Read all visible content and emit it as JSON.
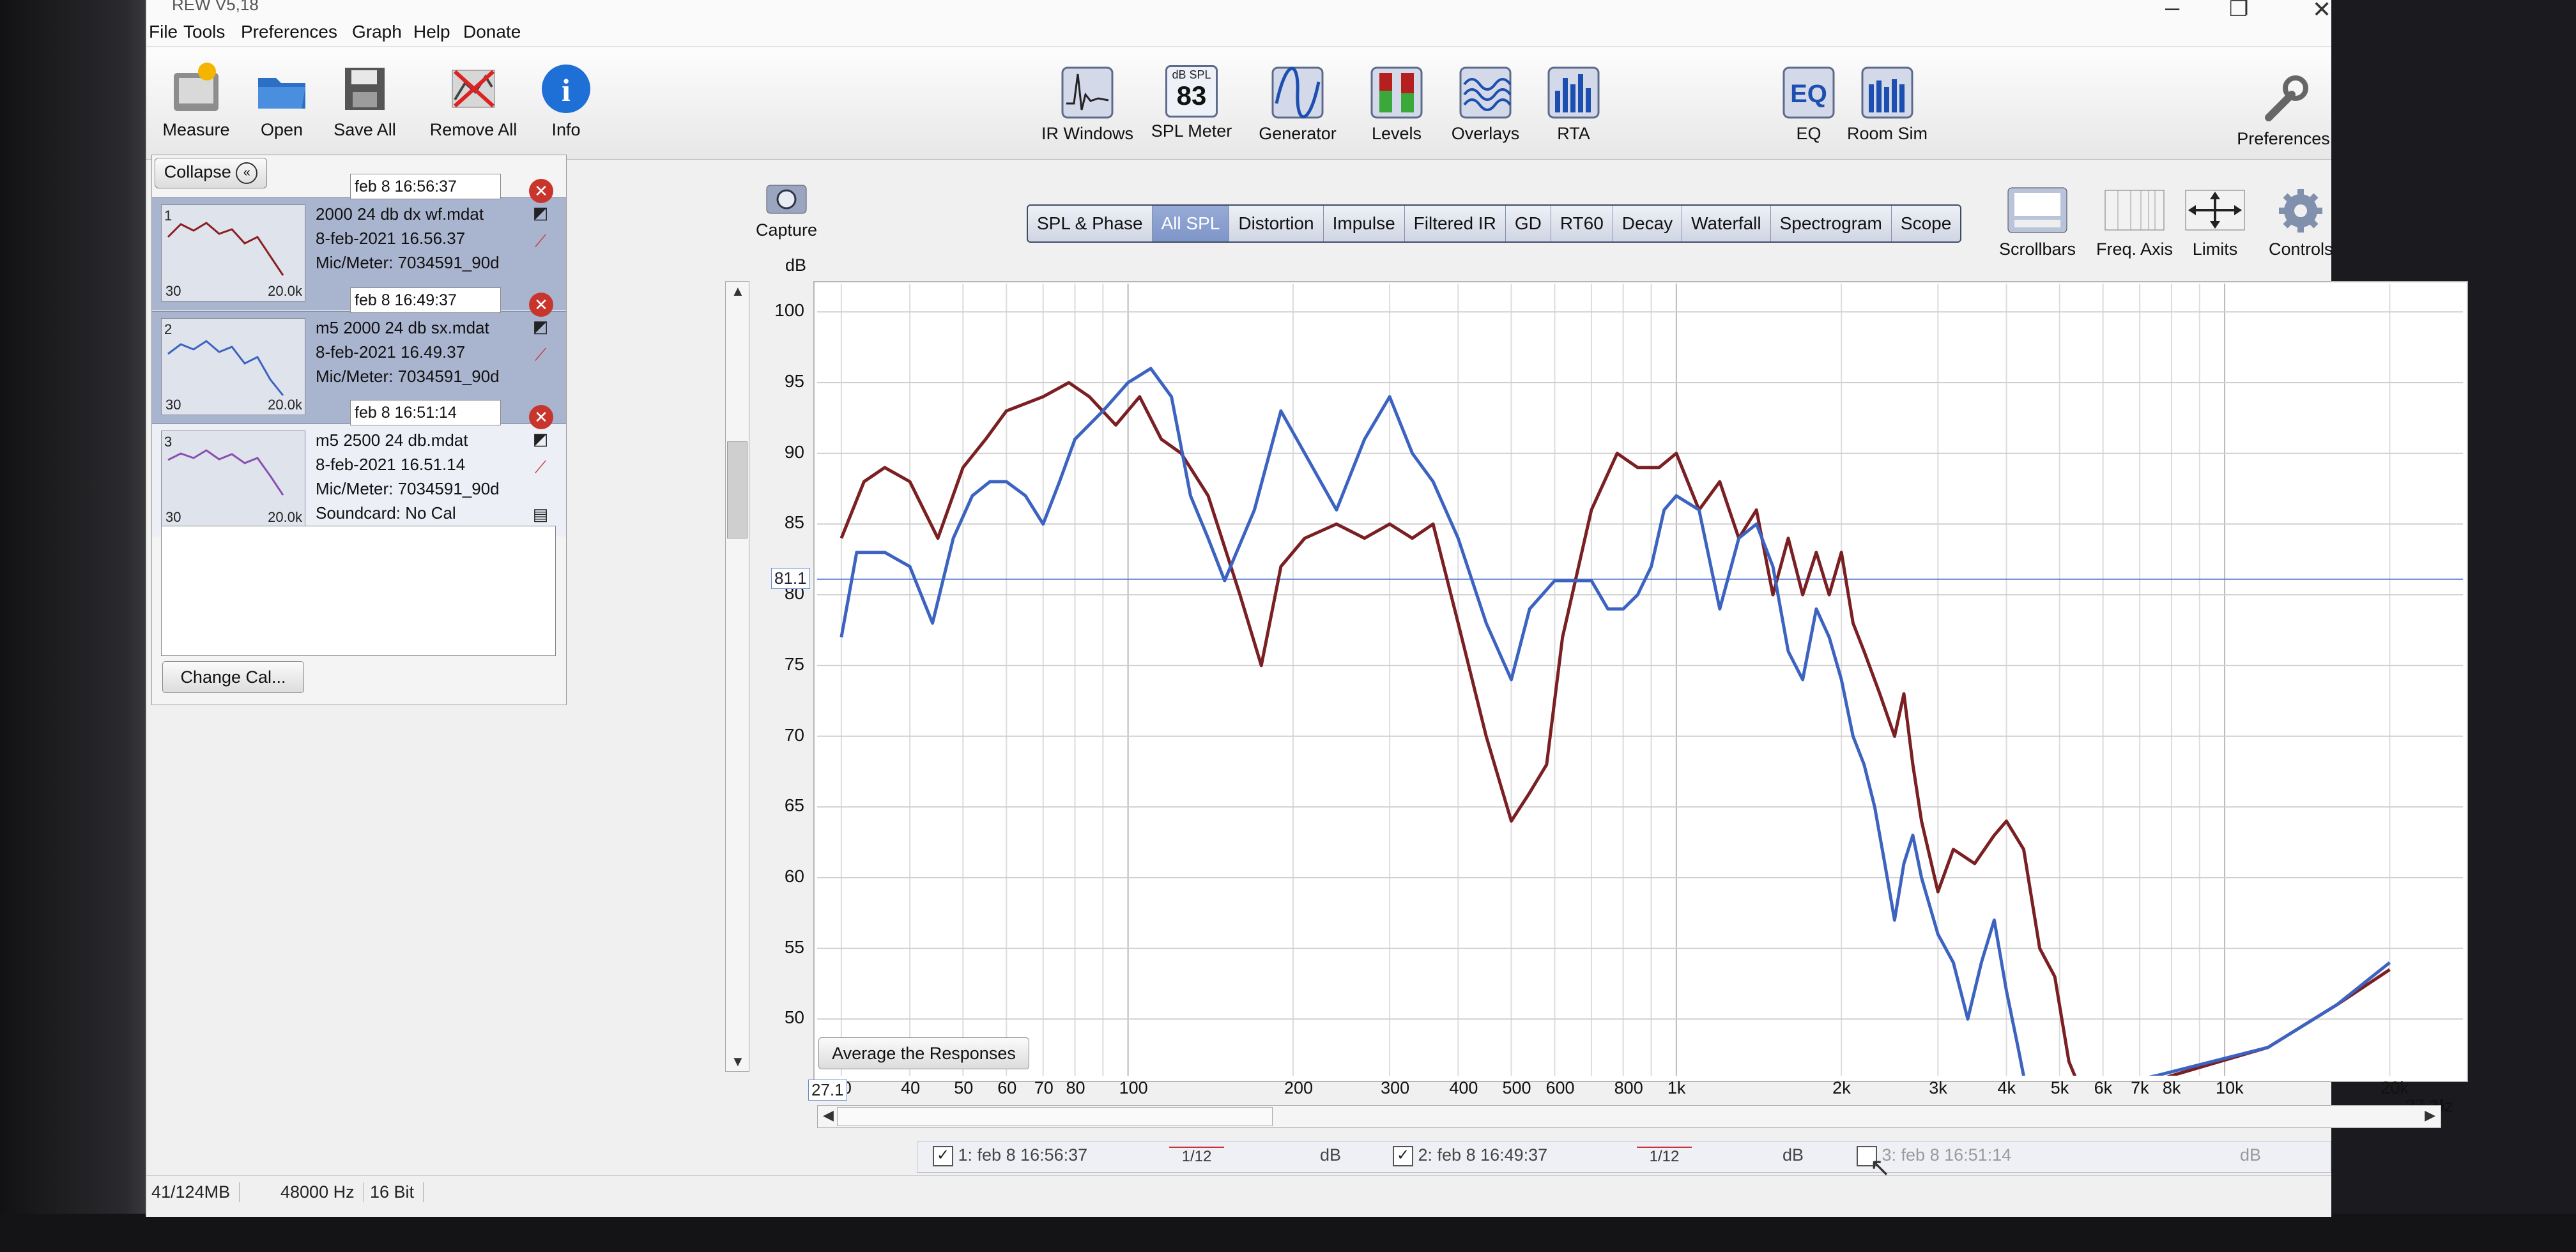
{
  "window": {
    "title": "REW V5,18"
  },
  "menu": [
    "File",
    "Tools",
    "Preferences",
    "Graph",
    "Help",
    "Donate"
  ],
  "toolbar_left": [
    {
      "label": "Measure",
      "icon": "measure-icon"
    },
    {
      "label": "Open",
      "icon": "folder-open-icon"
    },
    {
      "label": "Save All",
      "icon": "save-all-icon"
    },
    {
      "label": "Remove All",
      "icon": "remove-all-icon"
    },
    {
      "label": "Info",
      "icon": "info-icon"
    }
  ],
  "toolbar_center": [
    {
      "label": "IR Windows",
      "icon": "ir-windows-icon"
    },
    {
      "label": "SPL Meter",
      "icon": "spl-meter-icon",
      "badge_top": "dB SPL",
      "badge_value": "83"
    },
    {
      "label": "Generator",
      "icon": "generator-icon"
    },
    {
      "label": "Levels",
      "icon": "levels-icon"
    },
    {
      "label": "Overlays",
      "icon": "overlays-icon"
    },
    {
      "label": "RTA",
      "icon": "rta-icon"
    },
    {
      "label": "EQ",
      "icon": "eq-icon"
    },
    {
      "label": "Room Sim",
      "icon": "room-sim-icon"
    }
  ],
  "toolbar_right": {
    "label": "Preferences",
    "icon": "wrench-icon"
  },
  "panel": {
    "collapse_label": "Collapse",
    "change_cal_label": "Change Cal...",
    "measurements": [
      {
        "num": "1",
        "name_field": "feb 8 16:56:37",
        "file": "2000 24 db dx wf.mdat",
        "date": "8-feb-2021 16.56.37",
        "mic": "Mic/Meter: 7034591_90d",
        "range_lo": "30",
        "range_hi": "20.0k"
      },
      {
        "num": "2",
        "name_field": "feb 8 16:49:37",
        "file": "m5 2000 24 db sx.mdat",
        "date": "8-feb-2021 16.49.37",
        "mic": "Mic/Meter: 7034591_90d",
        "range_lo": "30",
        "range_hi": "20.0k"
      },
      {
        "num": "3",
        "name_field": "feb 8 16:51:14",
        "file": "m5 2500 24 db.mdat",
        "date": "8-feb-2021 16.51.14",
        "mic": "Mic/Meter: 7034591_90d",
        "soundcard": "Soundcard: No Cal",
        "range_lo": "30",
        "range_hi": "20.0k"
      }
    ]
  },
  "capture_label": "Capture",
  "graph_tabs": [
    "SPL & Phase",
    "All SPL",
    "Distortion",
    "Impulse",
    "Filtered IR",
    "GD",
    "RT60",
    "Decay",
    "Waterfall",
    "Spectrogram",
    "Scope"
  ],
  "selected_tab": "All SPL",
  "right_tools": [
    {
      "label": "Scrollbars",
      "icon": "scrollbars-icon"
    },
    {
      "label": "Freq. Axis",
      "icon": "freq-axis-icon"
    },
    {
      "label": "Limits",
      "icon": "limits-icon"
    },
    {
      "label": "Controls",
      "icon": "gear-icon"
    }
  ],
  "average_button": "Average the Responses",
  "legend": [
    {
      "checked": true,
      "label": "1: feb 8 16:56:37",
      "smoothing": "1/12",
      "unit": "dB"
    },
    {
      "checked": true,
      "label": "2: feb 8 16:49:37",
      "smoothing": "1/12",
      "unit": "dB"
    },
    {
      "checked": false,
      "label": "3: feb 8 16:51:14",
      "unit": "dB"
    }
  ],
  "status": {
    "memory": "41/124MB",
    "rate": "48000 Hz",
    "bits": "16 Bit"
  },
  "chart_data": {
    "type": "line",
    "ylabel": "dB",
    "xlabel": "Hz",
    "xscale": "log",
    "xlim": [
      27.1,
      27200
    ],
    "ylim": [
      46,
      102
    ],
    "yticks": [
      100,
      95,
      90,
      85,
      80,
      75,
      70,
      65,
      60,
      55,
      50
    ],
    "xticks": [
      {
        "v": 30,
        "t": "30"
      },
      {
        "v": 40,
        "t": "40"
      },
      {
        "v": 50,
        "t": "50"
      },
      {
        "v": 60,
        "t": "60"
      },
      {
        "v": 70,
        "t": "70"
      },
      {
        "v": 80,
        "t": "80"
      },
      {
        "v": 100,
        "t": "100"
      },
      {
        "v": 200,
        "t": "200"
      },
      {
        "v": 300,
        "t": "300"
      },
      {
        "v": 400,
        "t": "400"
      },
      {
        "v": 500,
        "t": "500"
      },
      {
        "v": 600,
        "t": "600"
      },
      {
        "v": 800,
        "t": "800"
      },
      {
        "v": 1000,
        "t": "1k"
      },
      {
        "v": 2000,
        "t": "2k"
      },
      {
        "v": 3000,
        "t": "3k"
      },
      {
        "v": 4000,
        "t": "4k"
      },
      {
        "v": 5000,
        "t": "5k"
      },
      {
        "v": 6000,
        "t": "6k"
      },
      {
        "v": 7000,
        "t": "7k"
      },
      {
        "v": 8000,
        "t": "8k"
      },
      {
        "v": 10000,
        "t": "10k"
      },
      {
        "v": 20000,
        "t": "20k"
      }
    ],
    "x_min_label": "27.1",
    "x_max_label": "27.2k",
    "cursor_value": 81.1,
    "series": [
      {
        "color": "#7a1f22",
        "points": [
          [
            30,
            84
          ],
          [
            33,
            88
          ],
          [
            36,
            89
          ],
          [
            40,
            88
          ],
          [
            45,
            84
          ],
          [
            50,
            89
          ],
          [
            55,
            91
          ],
          [
            60,
            93
          ],
          [
            70,
            94
          ],
          [
            78,
            95
          ],
          [
            85,
            94
          ],
          [
            95,
            92
          ],
          [
            105,
            94
          ],
          [
            115,
            91
          ],
          [
            125,
            90
          ],
          [
            140,
            87
          ],
          [
            160,
            80
          ],
          [
            175,
            75
          ],
          [
            190,
            82
          ],
          [
            210,
            84
          ],
          [
            240,
            85
          ],
          [
            270,
            84
          ],
          [
            300,
            85
          ],
          [
            330,
            84
          ],
          [
            360,
            85
          ],
          [
            400,
            78
          ],
          [
            450,
            70
          ],
          [
            500,
            64
          ],
          [
            540,
            66
          ],
          [
            580,
            68
          ],
          [
            620,
            77
          ],
          [
            700,
            86
          ],
          [
            780,
            90
          ],
          [
            850,
            89
          ],
          [
            930,
            89
          ],
          [
            1000,
            90
          ],
          [
            1100,
            86
          ],
          [
            1200,
            88
          ],
          [
            1300,
            84
          ],
          [
            1400,
            86
          ],
          [
            1500,
            80
          ],
          [
            1600,
            84
          ],
          [
            1700,
            80
          ],
          [
            1800,
            83
          ],
          [
            1900,
            80
          ],
          [
            2000,
            83
          ],
          [
            2100,
            78
          ],
          [
            2200,
            76
          ],
          [
            2350,
            73
          ],
          [
            2500,
            70
          ],
          [
            2600,
            73
          ],
          [
            2700,
            68
          ],
          [
            2800,
            64
          ],
          [
            3000,
            59
          ],
          [
            3200,
            62
          ],
          [
            3500,
            61
          ],
          [
            3800,
            63
          ],
          [
            4000,
            64
          ],
          [
            4300,
            62
          ],
          [
            4600,
            55
          ],
          [
            4900,
            53
          ],
          [
            5200,
            47
          ],
          [
            5600,
            44
          ],
          [
            8000,
            46
          ],
          [
            12000,
            48
          ],
          [
            16000,
            51
          ],
          [
            20000,
            53.5
          ]
        ]
      },
      {
        "color": "#3c63c0",
        "points": [
          [
            30,
            77
          ],
          [
            32,
            83
          ],
          [
            36,
            83
          ],
          [
            40,
            82
          ],
          [
            44,
            78
          ],
          [
            48,
            84
          ],
          [
            52,
            87
          ],
          [
            56,
            88
          ],
          [
            60,
            88
          ],
          [
            65,
            87
          ],
          [
            70,
            85
          ],
          [
            75,
            88
          ],
          [
            80,
            91
          ],
          [
            90,
            93
          ],
          [
            100,
            95
          ],
          [
            110,
            96
          ],
          [
            120,
            94
          ],
          [
            130,
            87
          ],
          [
            140,
            84
          ],
          [
            150,
            81
          ],
          [
            170,
            86
          ],
          [
            190,
            93
          ],
          [
            210,
            90
          ],
          [
            240,
            86
          ],
          [
            270,
            91
          ],
          [
            300,
            94
          ],
          [
            330,
            90
          ],
          [
            360,
            88
          ],
          [
            400,
            84
          ],
          [
            450,
            78
          ],
          [
            500,
            74
          ],
          [
            540,
            79
          ],
          [
            600,
            81
          ],
          [
            650,
            81
          ],
          [
            700,
            81
          ],
          [
            750,
            79
          ],
          [
            800,
            79
          ],
          [
            850,
            80
          ],
          [
            900,
            82
          ],
          [
            950,
            86
          ],
          [
            1000,
            87
          ],
          [
            1100,
            86
          ],
          [
            1200,
            79
          ],
          [
            1300,
            84
          ],
          [
            1400,
            85
          ],
          [
            1500,
            82
          ],
          [
            1600,
            76
          ],
          [
            1700,
            74
          ],
          [
            1800,
            79
          ],
          [
            1900,
            77
          ],
          [
            2000,
            74
          ],
          [
            2100,
            70
          ],
          [
            2200,
            68
          ],
          [
            2300,
            65
          ],
          [
            2400,
            61
          ],
          [
            2500,
            57
          ],
          [
            2600,
            61
          ],
          [
            2700,
            63
          ],
          [
            2800,
            60
          ],
          [
            3000,
            56
          ],
          [
            3200,
            54
          ],
          [
            3400,
            50
          ],
          [
            3600,
            54
          ],
          [
            3800,
            57
          ],
          [
            4000,
            52
          ],
          [
            4200,
            48
          ],
          [
            4400,
            44
          ],
          [
            7500,
            46
          ],
          [
            12000,
            48
          ],
          [
            16000,
            51
          ],
          [
            20000,
            54
          ]
        ]
      }
    ]
  }
}
